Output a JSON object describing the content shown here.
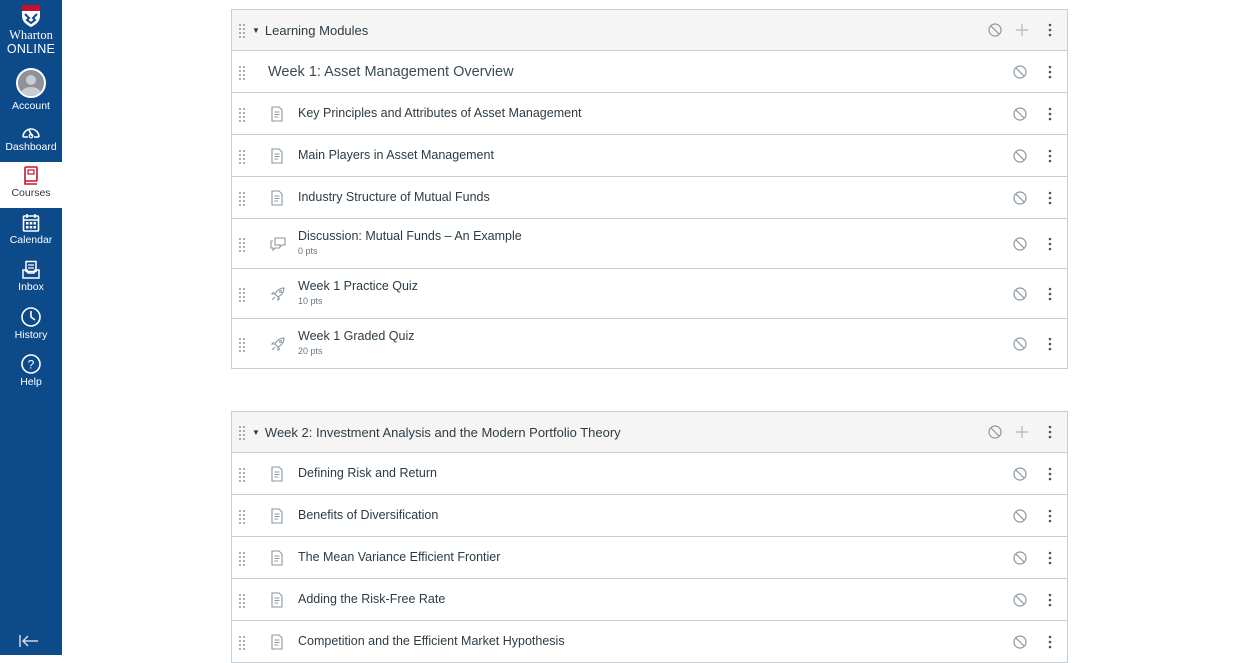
{
  "global_nav": {
    "brand": {
      "line1": "Wharton",
      "line2": "ONLINE"
    },
    "items": [
      {
        "id": "account",
        "label": "Account",
        "icon": "avatar-icon"
      },
      {
        "id": "dashboard",
        "label": "Dashboard",
        "icon": "speedometer-icon"
      },
      {
        "id": "courses",
        "label": "Courses",
        "icon": "book-icon",
        "active": true
      },
      {
        "id": "calendar",
        "label": "Calendar",
        "icon": "calendar-icon"
      },
      {
        "id": "inbox",
        "label": "Inbox",
        "icon": "inbox-icon"
      },
      {
        "id": "history",
        "label": "History",
        "icon": "clock-icon"
      },
      {
        "id": "help",
        "label": "Help",
        "icon": "question-icon"
      }
    ],
    "collapse_icon": "collapse-nav-icon",
    "colors": {
      "background": "#0c4a8a",
      "brand_red": "#c8102e",
      "active_icon": "#c8102e"
    }
  },
  "modules": [
    {
      "title": "Learning Modules",
      "items": [
        {
          "type": "subheader",
          "title": "Week 1: Asset Management Overview"
        },
        {
          "type": "page",
          "title": "Key Principles and Attributes of Asset Management"
        },
        {
          "type": "page",
          "title": "Main Players in Asset Management"
        },
        {
          "type": "page",
          "title": "Industry Structure of Mutual Funds"
        },
        {
          "type": "discussion",
          "title": "Discussion: Mutual Funds – An Example",
          "points": "0 pts"
        },
        {
          "type": "quiz",
          "title": "Week 1 Practice Quiz",
          "points": "10 pts"
        },
        {
          "type": "quiz",
          "title": "Week 1 Graded Quiz",
          "points": "20 pts"
        }
      ]
    },
    {
      "title": "Week 2: Investment Analysis and the Modern Portfolio Theory",
      "items": [
        {
          "type": "page",
          "title": "Defining Risk and Return"
        },
        {
          "type": "page",
          "title": "Benefits of Diversification"
        },
        {
          "type": "page",
          "title": "The Mean Variance Efficient Frontier"
        },
        {
          "type": "page",
          "title": "Adding the Risk-Free Rate"
        },
        {
          "type": "page",
          "title": "Competition and the Efficient Market Hypothesis"
        }
      ]
    }
  ]
}
